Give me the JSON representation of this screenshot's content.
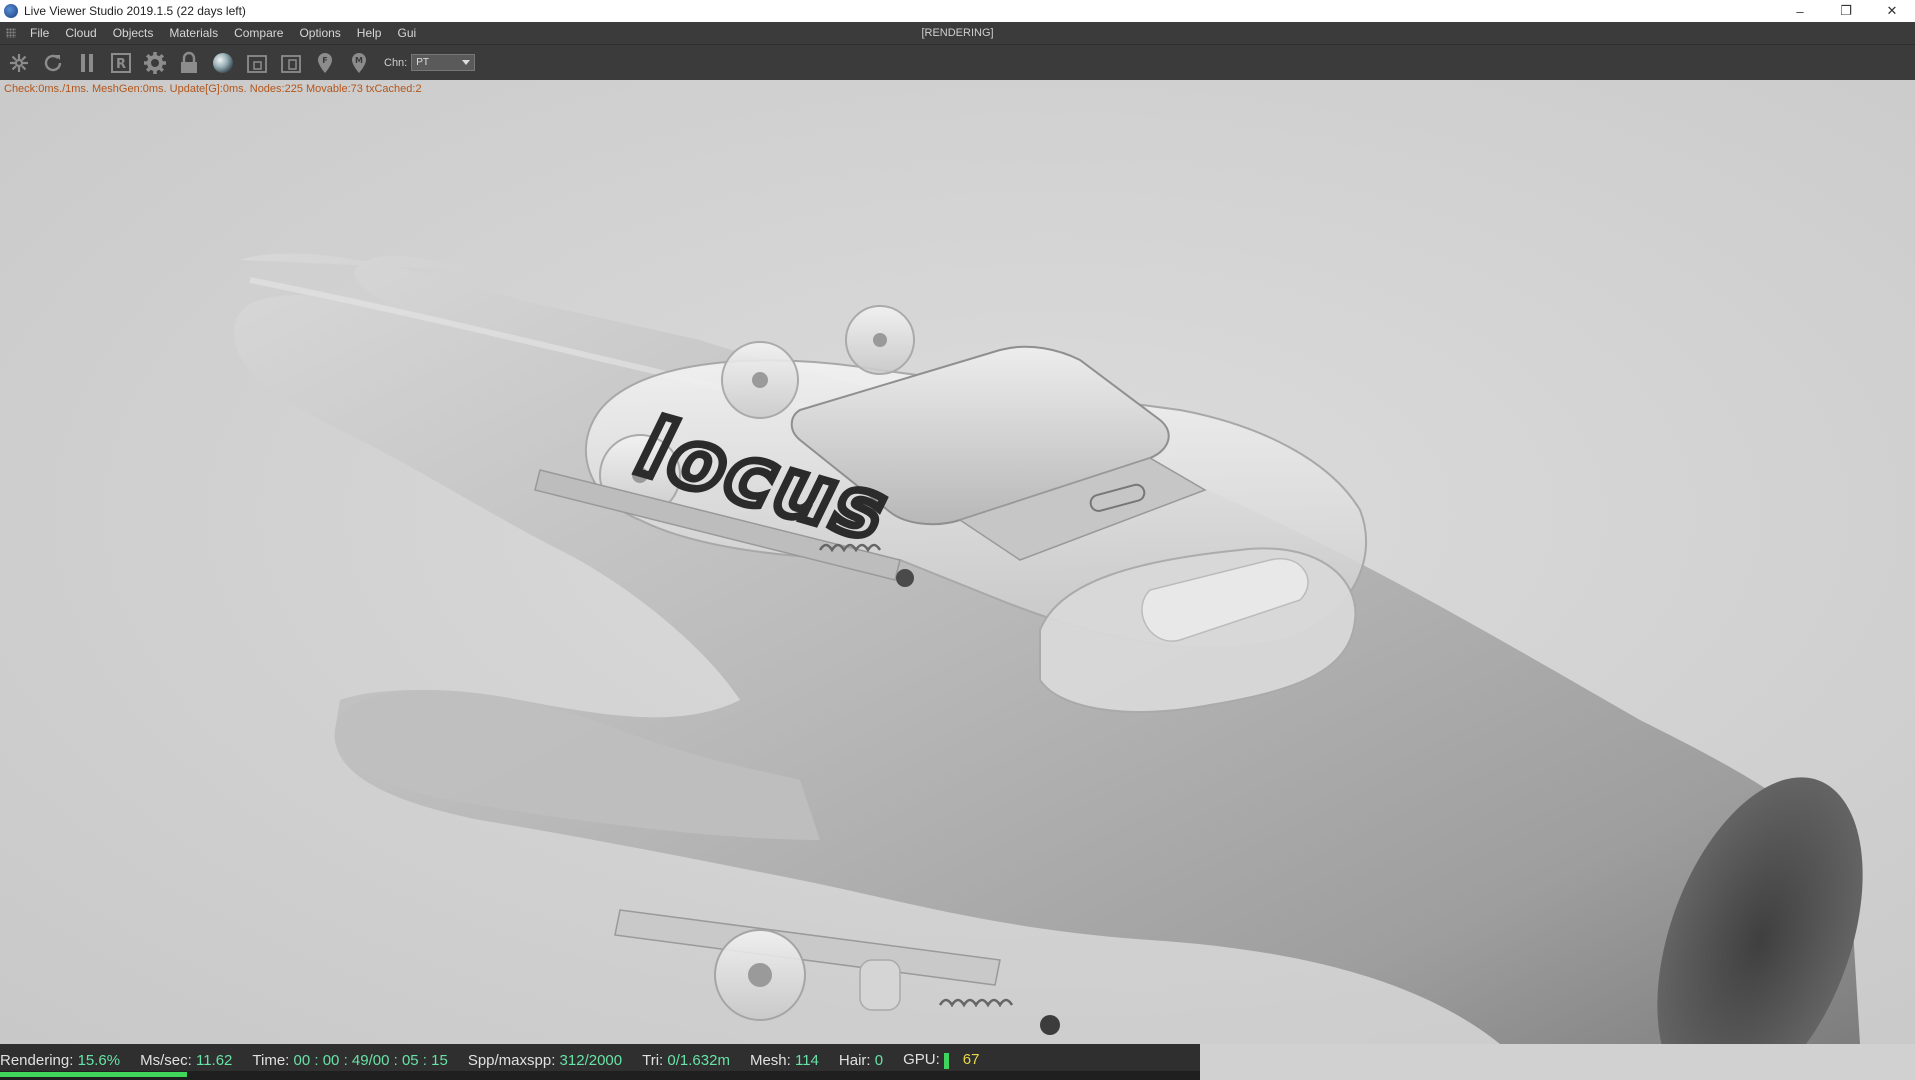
{
  "window": {
    "title": "Live Viewer Studio 2019.1.5 (22 days left)",
    "status": "[RENDERING]",
    "minimize_glyph": "–",
    "restore_glyph": "❐",
    "close_glyph": "✕"
  },
  "menu": {
    "items": [
      "File",
      "Cloud",
      "Objects",
      "Materials",
      "Compare",
      "Options",
      "Help",
      "Gui"
    ]
  },
  "toolbar": {
    "icons": [
      "render-sphere-icon",
      "refresh-icon",
      "pause-icon",
      "region-r-icon",
      "gear-icon",
      "lock-icon",
      "material-ball-icon",
      "crop-region-icon",
      "film-region-icon",
      "pick-focus-icon",
      "pick-material-icon"
    ],
    "chn_label": "Chn:",
    "chn_value": "PT"
  },
  "info": {
    "line": "Check:0ms./1ms. MeshGen:0ms. Update[G]:0ms. Nodes:225 Movable:73 txCached:2"
  },
  "status": {
    "rendering_label": "Rendering:",
    "rendering_value": "15.6%",
    "rendering_fraction": 0.156,
    "mssec_label": "Ms/sec:",
    "mssec_value": "11.62",
    "time_label": "Time:",
    "time_value": "00 : 00 : 49/00 : 05 : 15",
    "spp_label": "Spp/maxspp:",
    "spp_value": "312/2000",
    "tri_label": "Tri:",
    "tri_value": "0/1.632m",
    "mesh_label": "Mesh:",
    "mesh_value": "114",
    "hair_label": "Hair:",
    "hair_value": "0",
    "gpu_label": "GPU:",
    "gpu_value": "67"
  },
  "scene": {
    "logo_text": "locus"
  },
  "colors": {
    "toolbar_bg": "#3b3b3b",
    "info_text": "#b3561a",
    "status_value": "#67e3a5",
    "gpu_value": "#e6d84a",
    "progress": "#40d55b"
  }
}
